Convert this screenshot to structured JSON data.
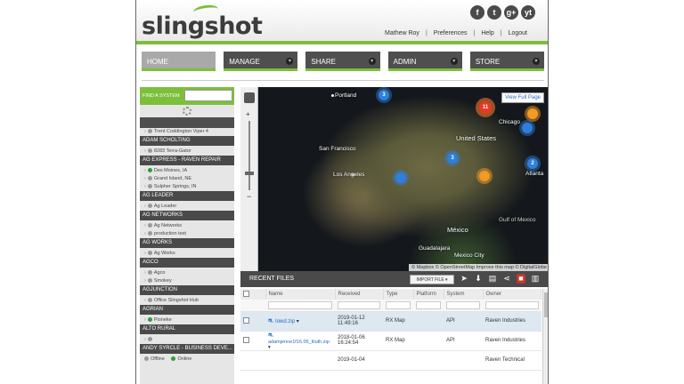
{
  "app": {
    "logo": "slingshot"
  },
  "social": [
    "f",
    "t",
    "g+",
    "yt"
  ],
  "user_nav": {
    "user": "Mathew Roy",
    "preferences": "Preferences",
    "help": "Help",
    "logout": "Logout"
  },
  "main_nav": [
    {
      "label": "HOME"
    },
    {
      "label": "MANAGE"
    },
    {
      "label": "SHARE"
    },
    {
      "label": "ADMIN"
    },
    {
      "label": "STORE"
    }
  ],
  "sidebar": {
    "find_label": "FIND A SYSTEM",
    "groups": [
      {
        "subs": [
          {
            "text": "Trent Coddington Viper 4",
            "status": "off"
          }
        ],
        "name": "ADAM SCHOLTING"
      },
      {
        "subs": [
          {
            "text": "8283 Terra-Gator",
            "status": "off"
          }
        ],
        "name": "AG EXPRESS - RAVEN REPAIR"
      },
      {
        "subs": [
          {
            "text": "Des Moines, IA",
            "status": "on"
          },
          {
            "text": "Grand Island, NE",
            "status": "off"
          },
          {
            "text": "Sulpher Springs, IN",
            "status": "off"
          }
        ],
        "name": "AG LEADER"
      },
      {
        "subs": [
          {
            "text": "Ag Leader",
            "status": "off"
          }
        ],
        "name": "AG NETWORKS"
      },
      {
        "subs": [
          {
            "text": "Ag Networks",
            "status": "off"
          },
          {
            "text": "production test",
            "status": "off"
          }
        ],
        "name": "AG WORKS"
      },
      {
        "subs": [
          {
            "text": "Ag Works",
            "status": "off"
          }
        ],
        "name": "AGCO"
      },
      {
        "subs": [
          {
            "text": "Agco",
            "status": "off"
          },
          {
            "text": "Smokey",
            "status": "off"
          }
        ],
        "name": "AGJUNCTION"
      },
      {
        "subs": [
          {
            "text": "Office Slingshot Hub",
            "status": "off"
          }
        ],
        "name": "AGRIAN"
      },
      {
        "subs": [
          {
            "text": "Pioneke",
            "status": "on"
          }
        ],
        "name": "ALTO RURAL"
      },
      {
        "subs": [
          {
            "text": "",
            "status": "off"
          }
        ],
        "name": "ANDY SYRCLE - BUSINESS DEVE..."
      }
    ],
    "footer": {
      "offline": "Offline",
      "online": "Online"
    }
  },
  "map": {
    "view_full": "View Full Page",
    "attribution": "© Mapbox © OpenStreetMap Improve this map © DigitalGlobe",
    "cities": [
      "Portland",
      "San Francisco",
      "Los Angeles",
      "United States",
      "Chicago",
      "Atlanta",
      "Gulf of Mexico",
      "México",
      "Guadalajara",
      "Mexico City"
    ],
    "clusters": [
      {
        "label": "3",
        "color": "blue"
      },
      {
        "label": "11",
        "color": "red"
      },
      {
        "label": "",
        "color": "orange"
      },
      {
        "label": "",
        "color": "blue"
      },
      {
        "label": "3",
        "color": "blue"
      },
      {
        "label": "",
        "color": "blue"
      },
      {
        "label": "2",
        "color": "blue"
      },
      {
        "label": "",
        "color": "orange"
      }
    ]
  },
  "recent_files": {
    "title": "RECENT FILES",
    "import_label": "IMPORT FILE ▾",
    "columns": [
      "Name",
      "Received",
      "Type",
      "Platform",
      "System",
      "Owner"
    ],
    "rows": [
      {
        "name": "Iowd.zip",
        "received": "2019-01-12 11:49:16",
        "type": "RX Map",
        "platform": "",
        "system": "API",
        "owner": "Raven Industries"
      },
      {
        "name": "adamjenne1f16.05_Iiluth.zip",
        "received": "2018-01-06 16:24:54",
        "type": "RX Map",
        "platform": "",
        "system": "API",
        "owner": "Raven Industries"
      },
      {
        "name": "",
        "received": "2019-01-04",
        "type": "",
        "platform": "",
        "system": "",
        "owner": "Raven Technical"
      }
    ]
  }
}
